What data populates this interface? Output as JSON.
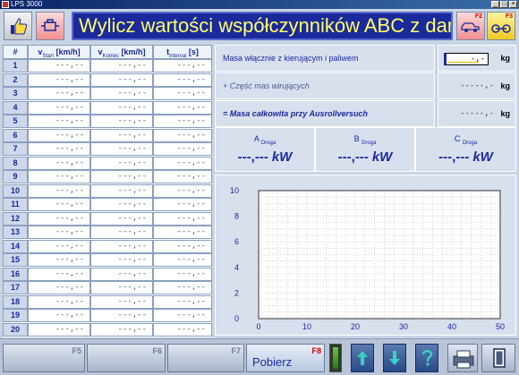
{
  "window": {
    "title": "LPS 3000",
    "controls": [
      "_",
      "□",
      "×"
    ]
  },
  "header": {
    "title": "Wylicz wartości współczynników ABC z danych",
    "f2_label": "F2",
    "f3_label": "F3"
  },
  "table": {
    "col_num": "#",
    "col_vstart": {
      "prefix": "v",
      "sub": "Start",
      "unit": "[km/h]"
    },
    "col_vend": {
      "prefix": "v",
      "sub": "Koniec",
      "unit": "[km/h]"
    },
    "col_tint": {
      "prefix": "t",
      "sub": "interval",
      "unit": "[s]"
    },
    "placeholder": "---,--",
    "rows": [
      "1",
      "2",
      "3",
      "4",
      "5",
      "6",
      "7",
      "8",
      "9",
      "10",
      "11",
      "12",
      "13",
      "14",
      "15",
      "16",
      "17",
      "18",
      "19",
      "20"
    ]
  },
  "panel": {
    "mass_label": "Masa włącznie z kierującym i paliwem",
    "mass_value": "-,-",
    "rot_label": "+ Część mas wirujących",
    "rot_value": "-----,-",
    "total_label": "= Masa całkowita przy Ausrollversuch",
    "total_value": "-----,-",
    "unit_kg": "kg"
  },
  "coefficients": {
    "a": {
      "name": "A",
      "sub": "Droga",
      "value": "---,---",
      "unit": "kW"
    },
    "b": {
      "name": "B",
      "sub": "Droga",
      "value": "---,---",
      "unit": "kW"
    },
    "c": {
      "name": "C",
      "sub": "Droga",
      "value": "---,---",
      "unit": "kW"
    }
  },
  "chart_data": {
    "type": "line",
    "title": "",
    "xlabel": "",
    "ylabel": "",
    "xlim": [
      0,
      50
    ],
    "ylim": [
      0,
      10
    ],
    "x_ticks": [
      0,
      10,
      20,
      30,
      40,
      50
    ],
    "y_ticks": [
      0,
      2,
      4,
      6,
      8,
      10
    ],
    "grid": true,
    "series": []
  },
  "bottom": {
    "f5": "F5",
    "f6": "F6",
    "f7": "F7",
    "f8": "F8",
    "pobierz": "Pobierz"
  },
  "colors": {
    "title_bg": "#1a2a9c",
    "title_fg": "#ffff66",
    "accent": "#1a2a9c",
    "fkey_red": "#d00000"
  }
}
